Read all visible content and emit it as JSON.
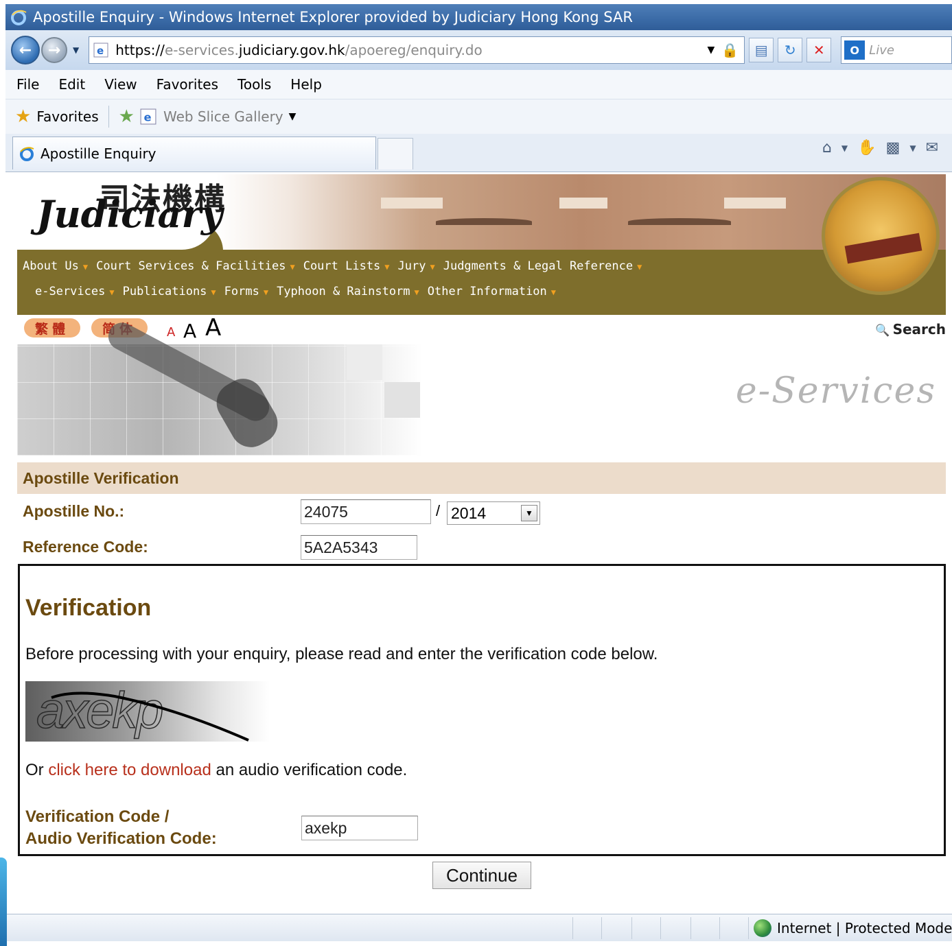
{
  "window": {
    "title": "Apostille Enquiry - Windows Internet Explorer provided by Judiciary Hong Kong SAR"
  },
  "address": {
    "scheme": "https://",
    "pre_host": "e-services.",
    "host": "judiciary.gov.hk",
    "path": "/apoereg/enquiry.do",
    "live_search": "Live"
  },
  "menu": [
    "File",
    "Edit",
    "View",
    "Favorites",
    "Tools",
    "Help"
  ],
  "favorites": {
    "label": "Favorites",
    "web_slice": "Web Slice Gallery"
  },
  "tab": {
    "title": "Apostille Enquiry"
  },
  "site": {
    "logo_zh": "司法機構",
    "logo_en": "Judiciary",
    "nav_row1": [
      "About Us",
      "Court Services & Facilities",
      "Court Lists",
      "Jury",
      "Judgments & Legal Reference"
    ],
    "nav_row2": [
      "e-Services",
      "Publications",
      "Forms",
      "Typhoon & Rainstorm",
      "Other Information"
    ],
    "lang_traditional": "繁體",
    "lang_simplified": "简体",
    "font_small": "A",
    "font_medium": "A",
    "font_large": "A",
    "search": "Search",
    "eservices_title": "e-Services"
  },
  "form": {
    "header": "Apostille Verification",
    "apostille_label": "Apostille No.:",
    "apostille_no": "24075",
    "separator": "/",
    "year": "2014",
    "reference_label": "Reference Code:",
    "reference_code": "5A2A5343"
  },
  "verification": {
    "title": "Verification",
    "instruction": "Before processing with your enquiry, please read and enter the verification code below.",
    "captcha_text": "axekp",
    "audio_prefix": "Or ",
    "audio_link": "click here to download",
    "audio_suffix": " an audio verification code.",
    "code_label_line1": "Verification Code /",
    "code_label_line2": "Audio Verification Code:",
    "code_value": "axekp"
  },
  "continue_label": "Continue",
  "status": {
    "zone": "Internet | Protected Mode:"
  },
  "colors": {
    "header_brown": "#6b4a10",
    "nav_band": "#7e6e2c",
    "link_red": "#b8301c",
    "section_beige": "#ecdccb"
  }
}
